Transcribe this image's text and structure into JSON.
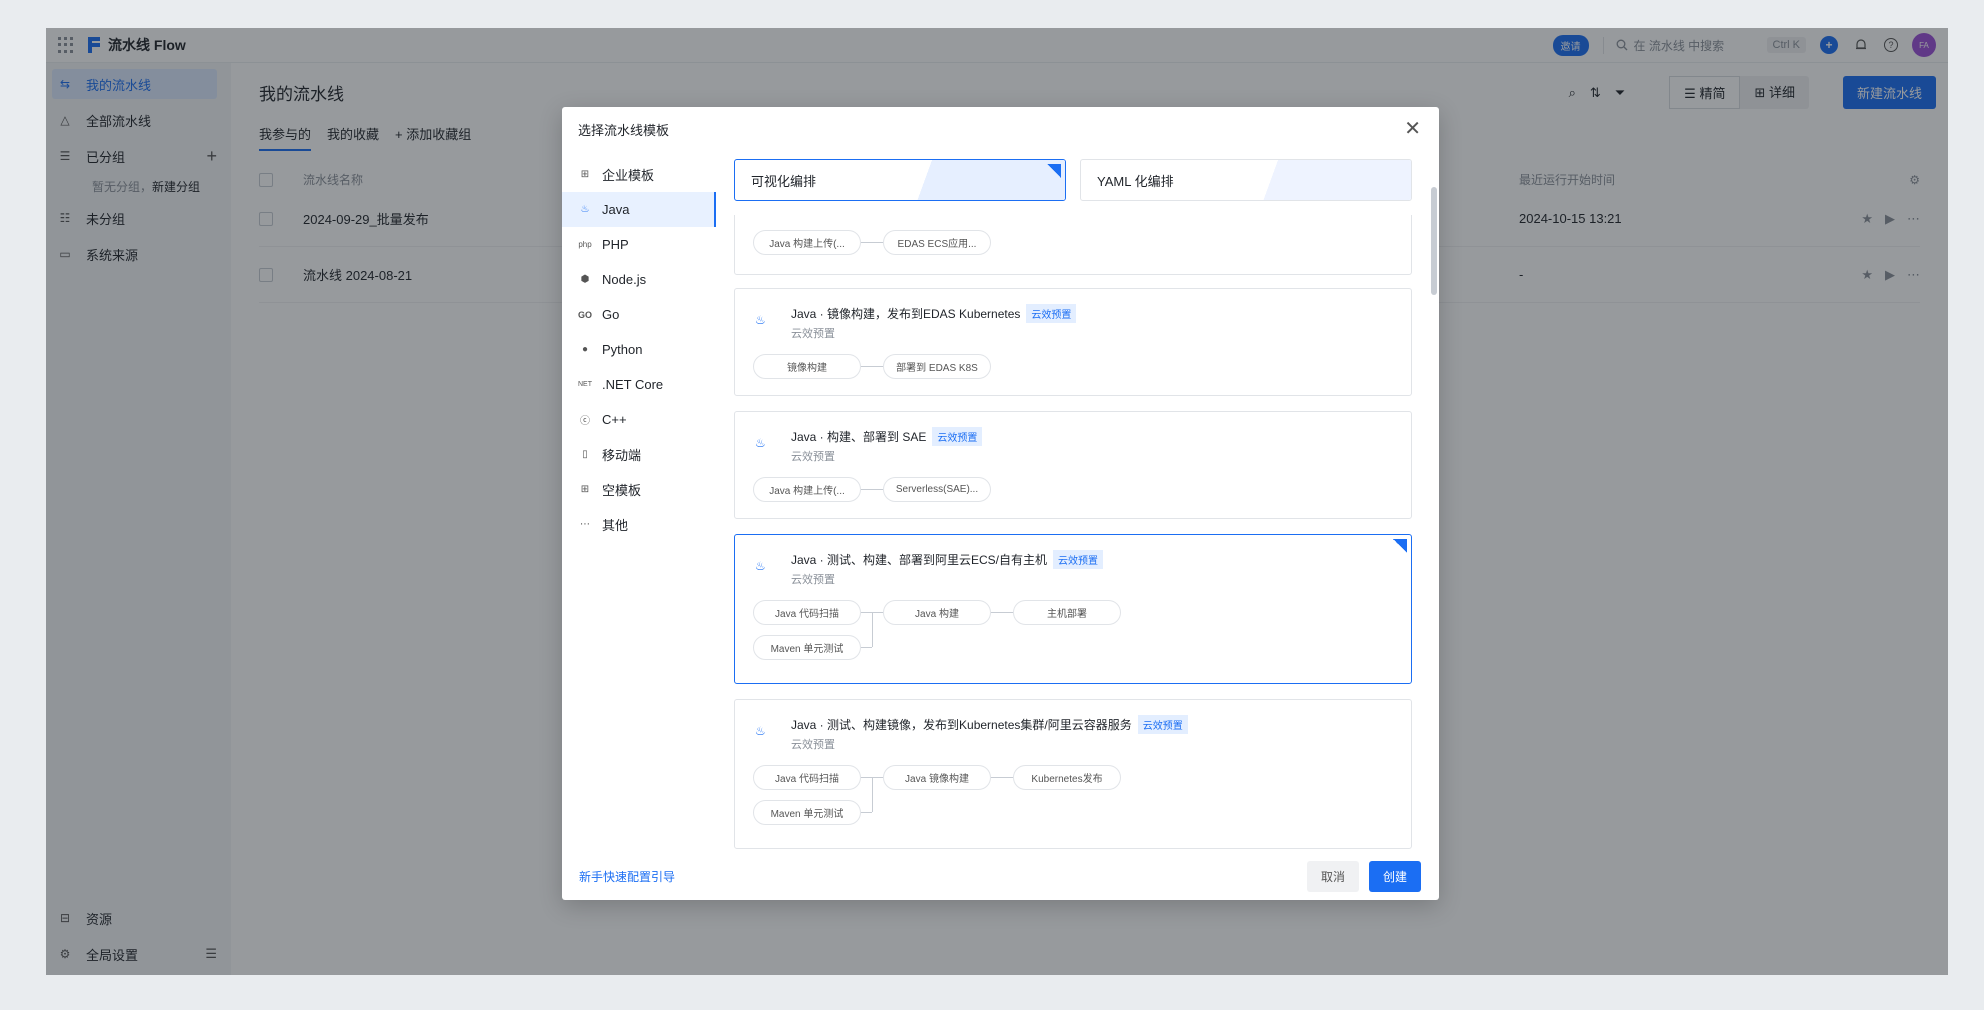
{
  "topbar": {
    "brand": "流水线 Flow",
    "invite": "邀请",
    "search_placeholder": "在 流水线 中搜索",
    "shortcut": "Ctrl K",
    "avatar": "FA"
  },
  "sidebar": {
    "items": [
      {
        "label": "我的流水线"
      },
      {
        "label": "全部流水线"
      },
      {
        "label": "已分组"
      },
      {
        "label": "未分组"
      },
      {
        "label": "系统来源"
      }
    ],
    "empty_group": "暂无分组，",
    "new_group": "新建分组",
    "bottom": [
      {
        "label": "资源"
      },
      {
        "label": "全局设置"
      }
    ]
  },
  "main": {
    "title": "我的流水线",
    "tabs": [
      "我参与的",
      "我的收藏"
    ],
    "add_fav_group": "添加收藏组",
    "view_simple": "精简",
    "view_detail": "详细",
    "new_button": "新建流水线",
    "columns": {
      "name": "流水线名称",
      "last_run": "最近运行开始时间"
    },
    "rows": [
      {
        "name": "2024-09-29_批量发布",
        "last_run": "2024-10-15 13:21"
      },
      {
        "name": "流水线 2024-08-21",
        "last_run": "-"
      }
    ]
  },
  "modal": {
    "title": "选择流水线模板",
    "nav": [
      "企业模板",
      "Java",
      "PHP",
      "Node.js",
      "Go",
      "Python",
      ".NET Core",
      "C++",
      "移动端",
      "空模板",
      "其他"
    ],
    "modes": [
      "可视化编排",
      "YAML 化编排"
    ],
    "badge": "云效预置",
    "partial_card": {
      "steps": [
        "Java 构建上传(...",
        "EDAS ECS应用..."
      ]
    },
    "cards": [
      {
        "title": "Java · 镜像构建，发布到EDAS Kubernetes",
        "sub": "云效预置",
        "steps": [
          "镜像构建",
          "部署到 EDAS K8S"
        ]
      },
      {
        "title": "Java · 构建、部署到 SAE",
        "sub": "云效预置",
        "steps": [
          "Java 构建上传(...",
          "Serverless(SAE)..."
        ]
      },
      {
        "title": "Java · 测试、构建、部署到阿里云ECS/自有主机",
        "sub": "云效预置",
        "steps": [
          "Java 代码扫描",
          "Java 构建",
          "主机部署",
          "Maven 单元测试"
        ]
      },
      {
        "title": "Java · 测试、构建镜像，发布到Kubernetes集群/阿里云容器服务",
        "sub": "云效预置",
        "steps": [
          "Java 代码扫描",
          "Java 镜像构建",
          "Kubernetes发布",
          "Maven 单元测试"
        ]
      }
    ],
    "guide": "新手快速配置引导",
    "cancel": "取消",
    "create": "创建"
  }
}
